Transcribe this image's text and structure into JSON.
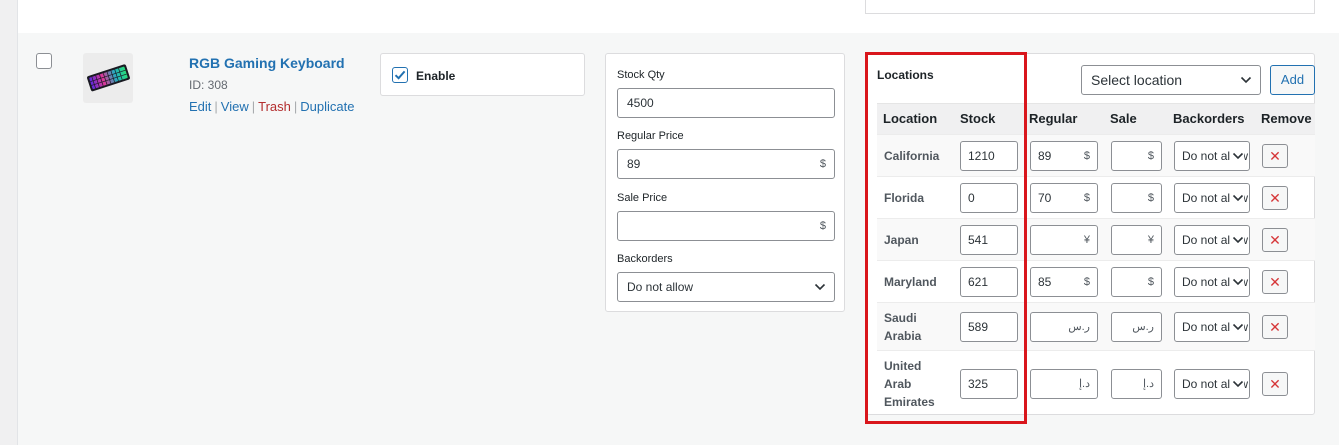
{
  "product": {
    "title": "RGB Gaming Keyboard",
    "id_text": "ID: 308",
    "actions": {
      "edit": "Edit",
      "view": "View",
      "trash": "Trash",
      "duplicate": "Duplicate",
      "separator": "|"
    },
    "enabled": true,
    "enable_label": "Enable"
  },
  "stock_panel": {
    "stock_qty_label": "Stock Qty",
    "stock_qty_value": "4500",
    "regular_price_label": "Regular Price",
    "regular_price_value": "89",
    "regular_price_currency": "$",
    "sale_price_label": "Sale Price",
    "sale_price_value": "",
    "sale_price_currency": "$",
    "backorders_label": "Backorders",
    "backorders_value": "Do not allow"
  },
  "locations_panel": {
    "title": "Locations",
    "select_placeholder": "Select location",
    "add_label": "Add",
    "columns": {
      "location": "Location",
      "stock": "Stock",
      "regular": "Regular",
      "sale": "Sale",
      "backorders": "Backorders",
      "remove": "Remove"
    },
    "rows": [
      {
        "name": "California",
        "stock": "1210",
        "regular": "89",
        "regular_currency": "$",
        "sale": "",
        "sale_currency": "$",
        "backorders": "Do not allow"
      },
      {
        "name": "Florida",
        "stock": "0",
        "regular": "70",
        "regular_currency": "$",
        "sale": "",
        "sale_currency": "$",
        "backorders": "Do not allow"
      },
      {
        "name": "Japan",
        "stock": "541",
        "regular": "",
        "regular_currency": "¥",
        "sale": "",
        "sale_currency": "¥",
        "backorders": "Do not allow"
      },
      {
        "name": "Maryland",
        "stock": "621",
        "regular": "85",
        "regular_currency": "$",
        "sale": "",
        "sale_currency": "$",
        "backorders": "Do not allow"
      },
      {
        "name": "Saudi Arabia",
        "stock": "589",
        "regular": "",
        "regular_currency": "ر.س",
        "sale": "",
        "sale_currency": "ر.س",
        "backorders": "Do not allow"
      },
      {
        "name": "United Arab Emirates",
        "stock": "325",
        "regular": "",
        "regular_currency": "د.إ",
        "sale": "",
        "sale_currency": "د.إ",
        "backorders": "Do not allow"
      }
    ],
    "remove_glyph": "✕"
  },
  "colors": {
    "link": "#2271b1",
    "trash": "#b32d2e",
    "highlight": "#d9161c",
    "remove_icon": "#d63638"
  },
  "icons": {
    "checkbox_check": "check-icon",
    "select_chevron": "chevron-down-icon",
    "remove": "close-icon",
    "thumbnail": "keyboard-product-image"
  }
}
